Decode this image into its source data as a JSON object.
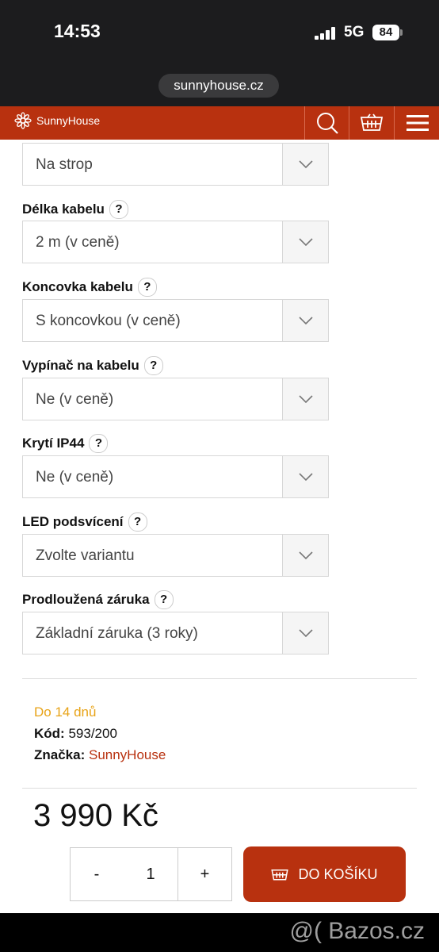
{
  "status_bar": {
    "time": "14:53",
    "network": "5G",
    "battery": "84"
  },
  "browser": {
    "url": "sunnyhouse.cz"
  },
  "header": {
    "logo_text": "SunnyHouse"
  },
  "options": [
    {
      "label": "",
      "value": "Na strop"
    },
    {
      "label": "Délka kabelu",
      "value": "2 m (v ceně)"
    },
    {
      "label": "Koncovka kabelu",
      "value": "S koncovkou (v ceně)"
    },
    {
      "label": "Vypínač na kabelu",
      "value": "Ne (v ceně)"
    },
    {
      "label": "Krytí IP44",
      "value": "Ne (v ceně)"
    },
    {
      "label": "LED podsvícení",
      "value": "Zvolte variantu"
    },
    {
      "label": "Prodloužená záruka",
      "value": "Základní záruka (3 roky)"
    }
  ],
  "help_symbol": "?",
  "availability": "Do 14 dnů",
  "code": {
    "label": "Kód:",
    "value": "593/200"
  },
  "brand": {
    "label": "Značka:",
    "value": "SunnyHouse"
  },
  "price": "3 990 Kč",
  "quantity": {
    "minus": "-",
    "value": "1",
    "plus": "+"
  },
  "add_to_cart": "DO KOŠÍKU",
  "watermark": "@( Bazos.cz",
  "colors": {
    "brand": "#b8310f",
    "availability": "#e8a317",
    "brand_link": "#b8310f"
  }
}
